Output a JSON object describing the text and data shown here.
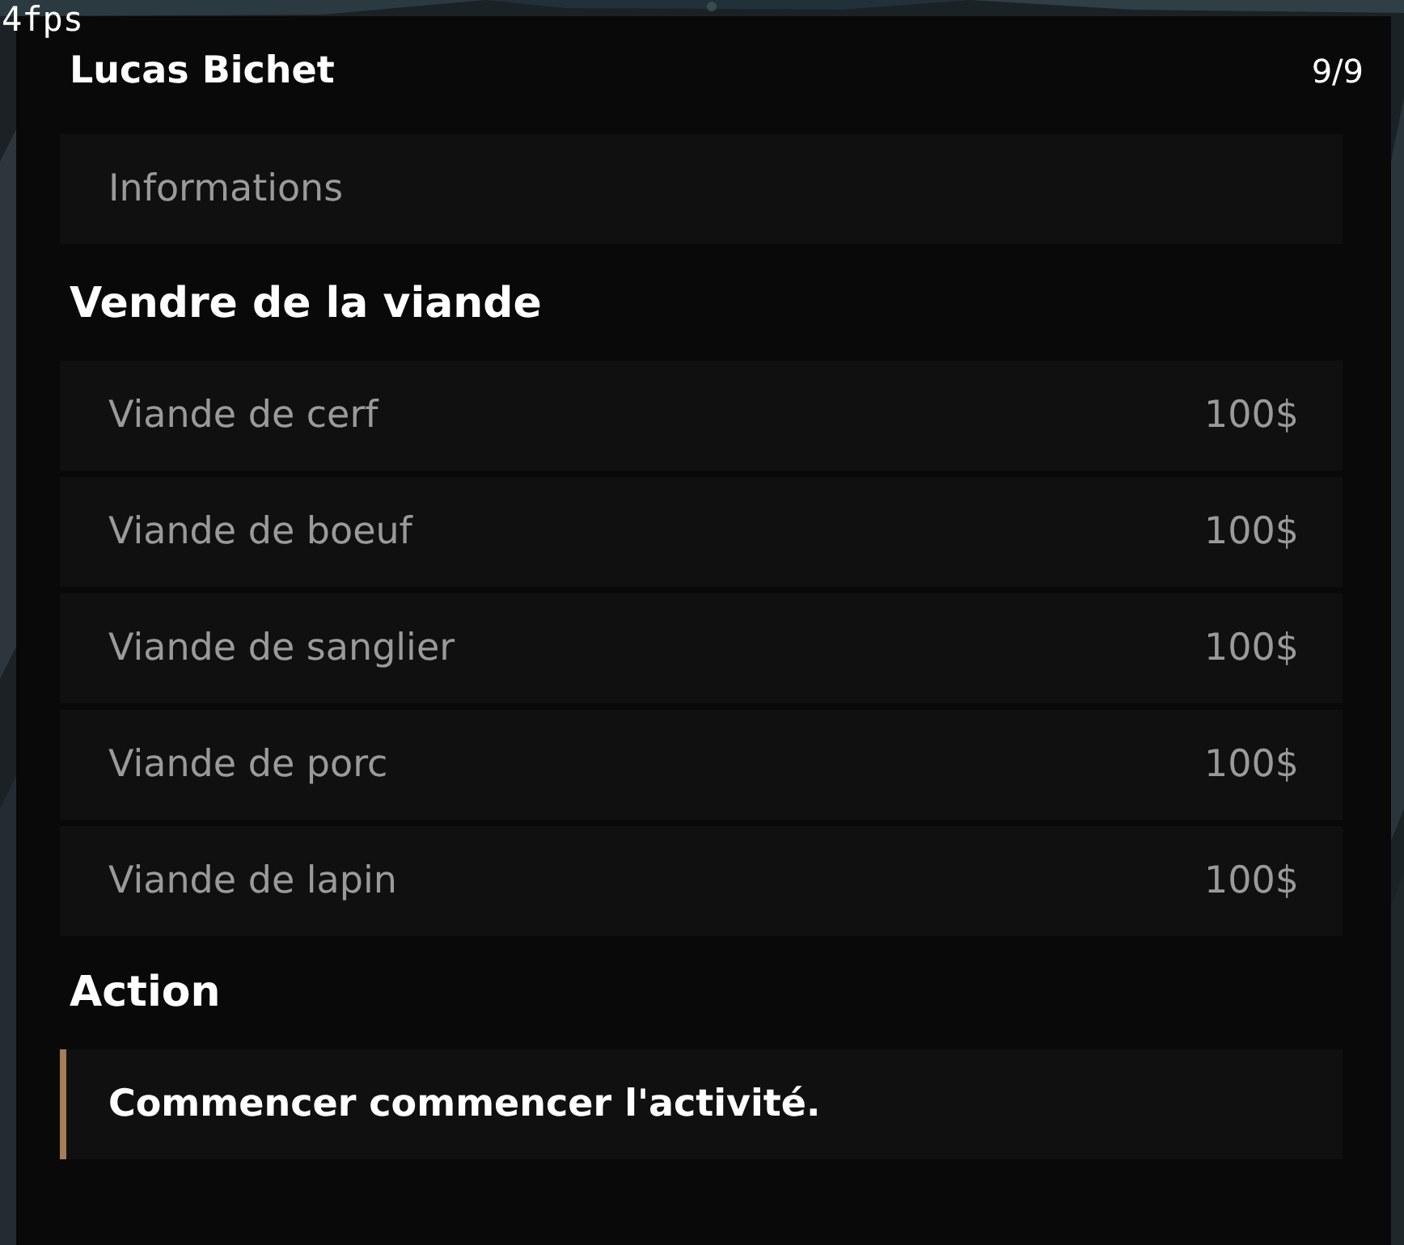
{
  "fps": "4fps",
  "header": {
    "title": "Lucas Bichet",
    "counter": "9/9"
  },
  "sections": [
    {
      "items": [
        {
          "label": "Informations",
          "selected": false
        }
      ]
    },
    {
      "title": "Vendre de la viande",
      "items": [
        {
          "label": "Viande de cerf",
          "price": "100$",
          "selected": false
        },
        {
          "label": "Viande de boeuf",
          "price": "100$",
          "selected": false
        },
        {
          "label": "Viande de sanglier",
          "price": "100$",
          "selected": false
        },
        {
          "label": "Viande de porc",
          "price": "100$",
          "selected": false
        },
        {
          "label": "Viande de lapin",
          "price": "100$",
          "selected": false
        }
      ]
    },
    {
      "title": "Action",
      "items": [
        {
          "label": "Commencer commencer l'activité.",
          "selected": true
        }
      ]
    }
  ]
}
